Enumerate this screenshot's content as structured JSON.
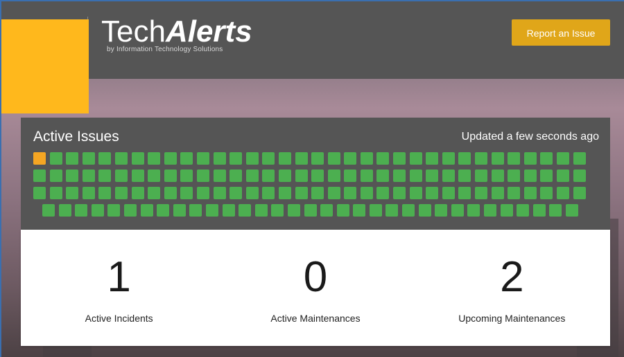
{
  "header": {
    "brand_tech": "Tech",
    "brand_alerts": "Alerts",
    "brand_sub": "by Information Technology Solutions",
    "report_button": "Report an Issue",
    "accent_color": "#e0a619",
    "logo_color": "#ffb81c"
  },
  "issues": {
    "title": "Active Issues",
    "updated": "Updated a few seconds ago",
    "rows": [
      [
        "warn",
        "ok",
        "ok",
        "ok",
        "ok",
        "ok",
        "ok",
        "ok",
        "ok",
        "ok",
        "ok",
        "ok",
        "ok",
        "ok",
        "ok",
        "ok",
        "ok",
        "ok",
        "ok",
        "ok",
        "ok",
        "ok",
        "ok",
        "ok",
        "ok",
        "ok",
        "ok",
        "ok",
        "ok",
        "ok",
        "ok",
        "ok",
        "ok",
        "ok"
      ],
      [
        "ok",
        "ok",
        "ok",
        "ok",
        "ok",
        "ok",
        "ok",
        "ok",
        "ok",
        "ok",
        "ok",
        "ok",
        "ok",
        "ok",
        "ok",
        "ok",
        "ok",
        "ok",
        "ok",
        "ok",
        "ok",
        "ok",
        "ok",
        "ok",
        "ok",
        "ok",
        "ok",
        "ok",
        "ok",
        "ok",
        "ok",
        "ok",
        "ok",
        "ok"
      ],
      [
        "ok",
        "ok",
        "ok",
        "ok",
        "ok",
        "ok",
        "ok",
        "ok",
        "ok",
        "ok",
        "ok",
        "ok",
        "ok",
        "ok",
        "ok",
        "ok",
        "ok",
        "ok",
        "ok",
        "ok",
        "ok",
        "ok",
        "ok",
        "ok",
        "ok",
        "ok",
        "ok",
        "ok",
        "ok",
        "ok",
        "ok",
        "ok",
        "ok",
        "ok"
      ],
      [
        "ok",
        "ok",
        "ok",
        "ok",
        "ok",
        "ok",
        "ok",
        "ok",
        "ok",
        "ok",
        "ok",
        "ok",
        "ok",
        "ok",
        "ok",
        "ok",
        "ok",
        "ok",
        "ok",
        "ok",
        "ok",
        "ok",
        "ok",
        "ok",
        "ok",
        "ok",
        "ok",
        "ok",
        "ok",
        "ok",
        "ok",
        "ok",
        "ok"
      ]
    ],
    "ok_color": "#4caf50",
    "warn_color": "#f5a623"
  },
  "stats": [
    {
      "number": "1",
      "label": "Active Incidents"
    },
    {
      "number": "0",
      "label": "Active Maintenances"
    },
    {
      "number": "2",
      "label": "Upcoming Maintenances"
    }
  ]
}
